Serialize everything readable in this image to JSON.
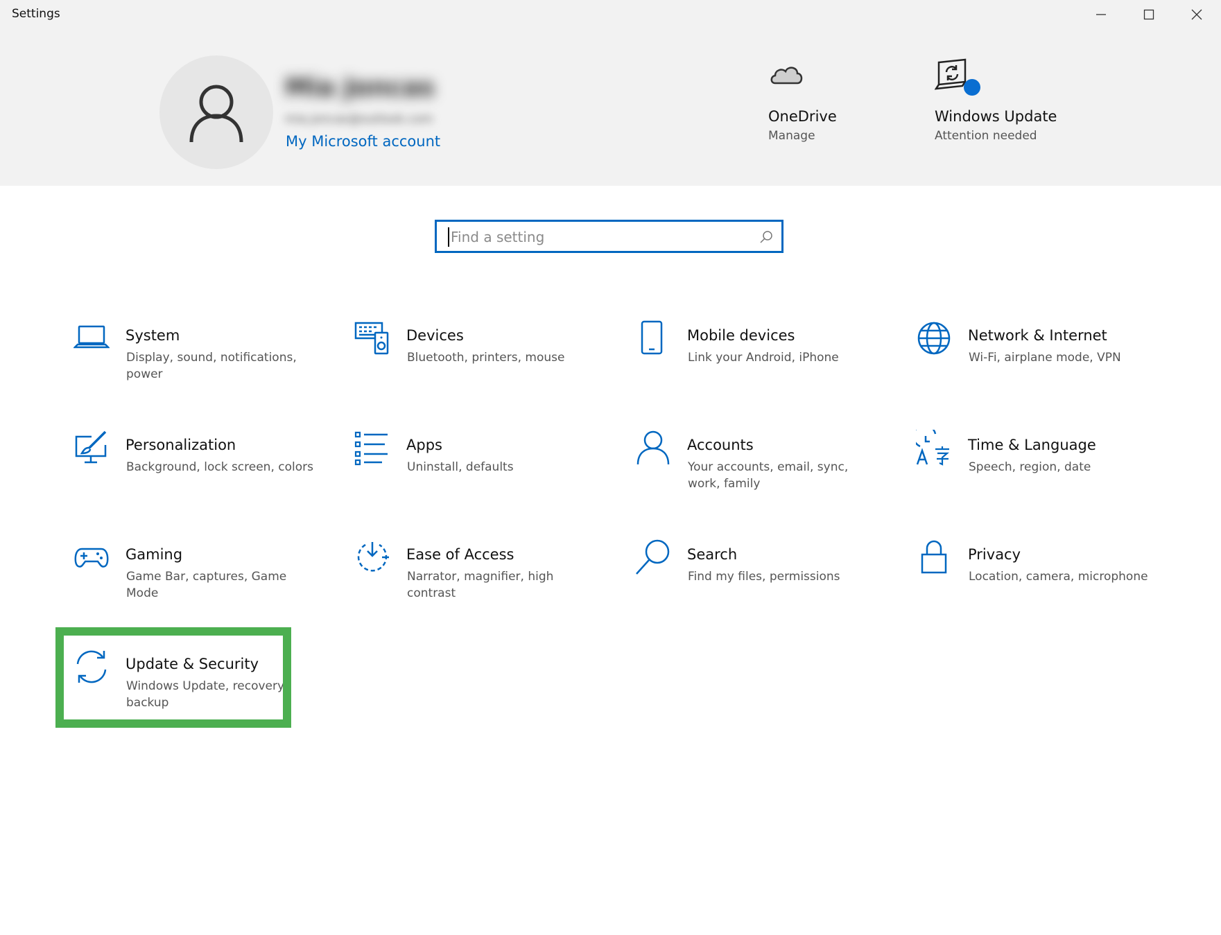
{
  "window": {
    "title": "Settings"
  },
  "header": {
    "user_name": "Mia Joncas",
    "user_email": "mia.joncas@outlook.com",
    "account_link": "My Microsoft account",
    "quick": [
      {
        "title": "OneDrive",
        "sub": "Manage",
        "icon": "cloud-icon"
      },
      {
        "title": "Windows Update",
        "sub": "Attention needed",
        "icon": "windows-update-icon"
      }
    ]
  },
  "search": {
    "placeholder": "Find a setting",
    "value": ""
  },
  "tiles": [
    {
      "title": "System",
      "desc": "Display, sound, notifications, power",
      "icon": "laptop-icon"
    },
    {
      "title": "Devices",
      "desc": "Bluetooth, printers, mouse",
      "icon": "devices-icon"
    },
    {
      "title": "Mobile devices",
      "desc": "Link your Android, iPhone",
      "icon": "phone-icon"
    },
    {
      "title": "Network & Internet",
      "desc": "Wi-Fi, airplane mode, VPN",
      "icon": "globe-icon"
    },
    {
      "title": "Personalization",
      "desc": "Background, lock screen, colors",
      "icon": "paint-icon"
    },
    {
      "title": "Apps",
      "desc": "Uninstall, defaults",
      "icon": "apps-list-icon"
    },
    {
      "title": "Accounts",
      "desc": "Your accounts, email, sync, work, family",
      "icon": "person-icon"
    },
    {
      "title": "Time & Language",
      "desc": "Speech, region, date",
      "icon": "time-language-icon"
    },
    {
      "title": "Gaming",
      "desc": "Game Bar, captures, Game Mode",
      "icon": "gamepad-icon"
    },
    {
      "title": "Ease of Access",
      "desc": "Narrator, magnifier, high contrast",
      "icon": "ease-of-access-icon"
    },
    {
      "title": "Search",
      "desc": "Find my files, permissions",
      "icon": "magnifier-icon"
    },
    {
      "title": "Privacy",
      "desc": "Location, camera, microphone",
      "icon": "lock-icon"
    },
    {
      "title": "Update & Security",
      "desc": "Windows Update, recovery, backup",
      "icon": "sync-icon"
    }
  ],
  "colors": {
    "accent": "#0067c0",
    "highlight": "#4caf50",
    "header_bg": "#f2f2f2"
  }
}
